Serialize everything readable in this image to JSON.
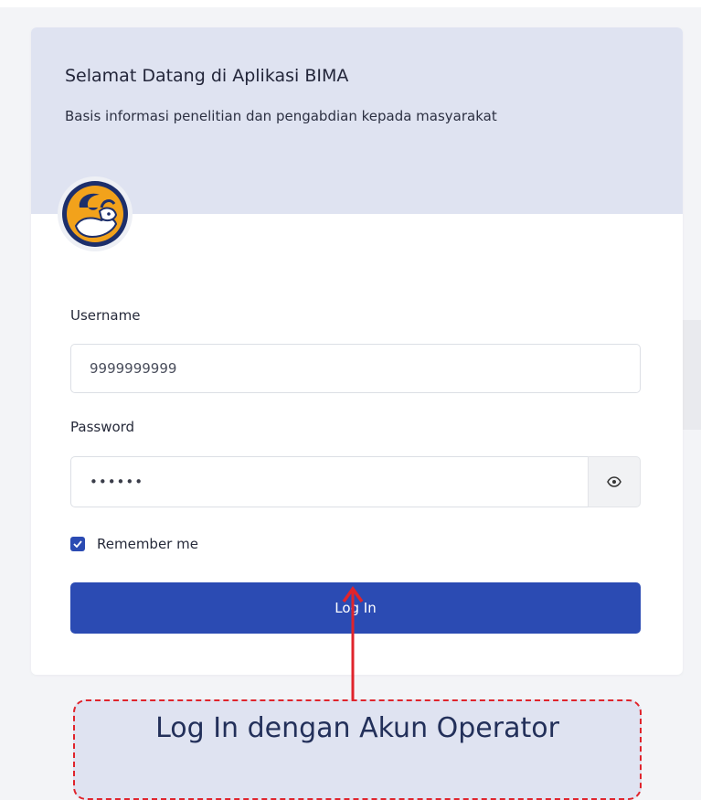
{
  "header": {
    "title": "Selamat Datang di Aplikasi BIMA",
    "subtitle": "Basis informasi penelitian dan pengabdian kepada masyarakat"
  },
  "logo": {
    "icon": "bima-logo"
  },
  "form": {
    "username_label": "Username",
    "username_value": "9999999999",
    "password_label": "Password",
    "password_value": "••••••",
    "remember_label": "Remember me",
    "remember_checked": true,
    "login_label": "Log In"
  },
  "annotation": {
    "text": "Log In dengan Akun Operator"
  },
  "colors": {
    "primary": "#2b4bb3",
    "header_bg": "#dfe3f1",
    "annotation_border": "#e0242c",
    "logo_orange": "#f2a21b",
    "logo_navy": "#1d2f6b"
  }
}
